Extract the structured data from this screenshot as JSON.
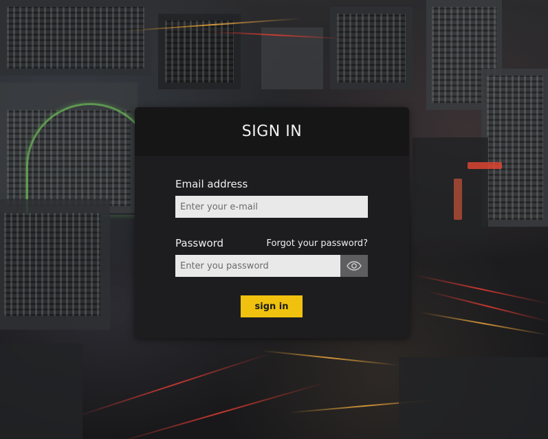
{
  "card": {
    "title": "SIGN IN"
  },
  "email": {
    "label": "Email address",
    "placeholder": "Enter your e-mail",
    "value": ""
  },
  "password": {
    "label": "Password",
    "placeholder": "Enter you password",
    "value": "",
    "forgot_link": "Forgot your password?",
    "toggle_icon": "eye-icon"
  },
  "actions": {
    "submit_label": "sign in"
  },
  "colors": {
    "accent": "#f0c20f",
    "card_background": "#1d1c1e",
    "card_header": "#171617",
    "input_background": "#e9e9ea",
    "toggle_background": "#5e5e60"
  }
}
